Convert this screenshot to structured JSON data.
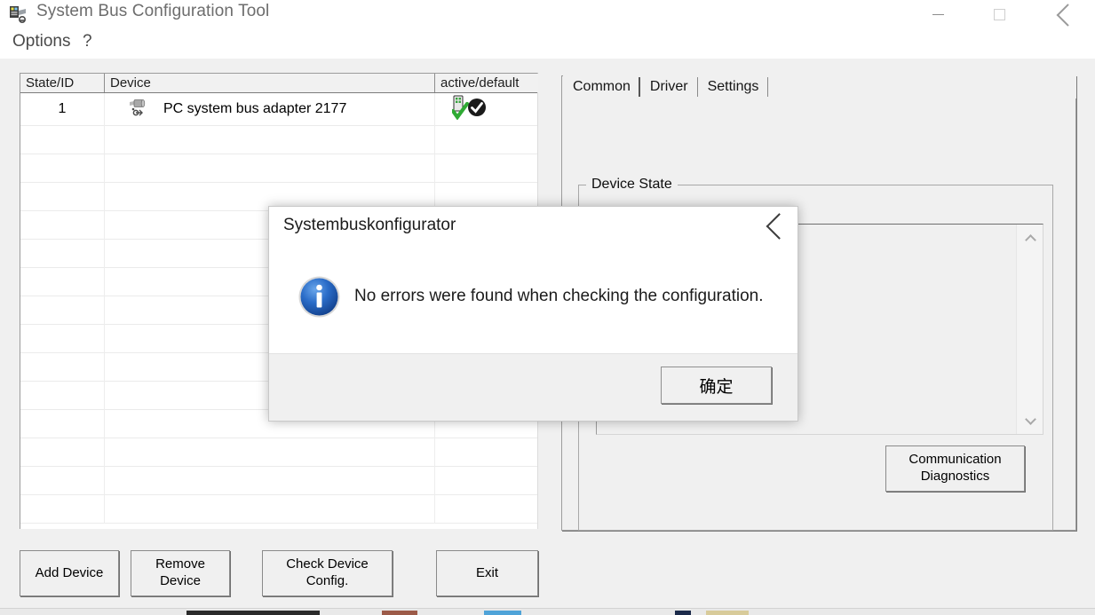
{
  "window": {
    "title": "System Bus Configuration Tool",
    "icon": "bus-adapter-icon",
    "controls": {
      "minimize": "minimize-icon",
      "maximize": "maximize-icon",
      "close": "close-icon"
    }
  },
  "menubar": {
    "items": [
      {
        "label": "Options"
      },
      {
        "label": "?"
      }
    ]
  },
  "device_table": {
    "columns": [
      "State/ID",
      "Device",
      "active/default"
    ],
    "rows": [
      {
        "state_id": "1",
        "device": "PC system bus adapter 2177",
        "device_icon": "usb-adapter-icon",
        "active_icon": "green-check-device-icon",
        "default_icon": "black-check-circle-icon"
      }
    ],
    "empty_row_count": 14
  },
  "action_buttons": [
    {
      "label": "Add Device",
      "name": "add-device-button"
    },
    {
      "label": "Remove\nDevice",
      "name": "remove-device-button"
    },
    {
      "label": "Check Device\nConfig.",
      "name": "check-device-config-button"
    },
    {
      "label": "Exit",
      "name": "exit-button"
    }
  ],
  "right_panel": {
    "tabs": [
      {
        "label": "Common",
        "active": true
      },
      {
        "label": "Driver",
        "active": false
      },
      {
        "label": "Settings",
        "active": false
      }
    ],
    "groupbox": {
      "title": "Device State",
      "list_items": [],
      "scrollbar": {
        "up": "chevron-up-icon",
        "down": "chevron-down-icon"
      }
    },
    "comm_diag_button": {
      "label": "Communication\nDiagnostics"
    }
  },
  "dialog": {
    "title": "Systembuskonfigurator",
    "icon": "info-icon",
    "message": "No errors were found when checking the configuration.",
    "ok_label": "确定",
    "close_icon": "close-icon"
  },
  "colors": {
    "window_bg": "#ffffff",
    "client_bg": "#f0f0f0",
    "table_bg": "#ffffff",
    "button_face": "#f0f0f0",
    "border": "#8a8a8a",
    "title_text": "#6d6d6d",
    "info_blue": "#1f5fc4",
    "check_green": "#2faa34"
  }
}
